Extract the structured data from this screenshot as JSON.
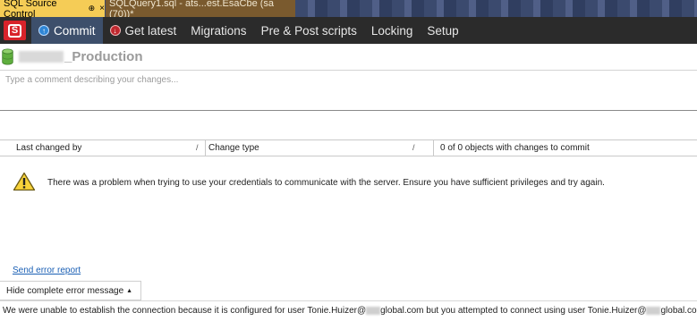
{
  "tabs": {
    "active_label": "SQL Source Control",
    "active_pin": "⊕",
    "active_close": "×",
    "query_label": "SQLQuery1.sql - ats...est.EsaCbe (sa (70))*"
  },
  "toolbar": {
    "logo_text": "S",
    "items": [
      {
        "label": "Commit",
        "icon": "commit-icon",
        "active": true
      },
      {
        "label": "Get latest",
        "icon": "get-latest-icon",
        "active": false
      },
      {
        "label": "Migrations",
        "active": false
      },
      {
        "label": "Pre & Post scripts",
        "active": false
      },
      {
        "label": "Locking",
        "active": false
      },
      {
        "label": "Setup",
        "active": false
      }
    ]
  },
  "database": {
    "name_suffix": "_Production",
    "icon": "database-icon"
  },
  "comment": {
    "placeholder": "Type a comment describing your changes..."
  },
  "grid": {
    "col_last_changed": "Last changed by",
    "col_change_type": "Change type",
    "sort_glyph": "/",
    "objects_count": "0 of 0 objects with changes to commit"
  },
  "error": {
    "message": "There was a problem when trying to use your credentials to communicate with the server. Ensure you have sufficient privileges and try again.",
    "send_report": "Send error report",
    "hide_button": "Hide complete error message",
    "hide_caret": "▲",
    "detail_part1": "We were unable to establish the connection because it is configured for user Tonie.Huizer@",
    "detail_part2": "global.com but you attempted to connect using user Tonie.Huizer@",
    "detail_part3": "global.com. To co"
  },
  "colors": {
    "active_tab": "#f5cc56",
    "toolbar_bg": "#2b2b2b",
    "active_nav": "#3d4f6b",
    "logo_red": "#d8232a",
    "link": "#1a5fb4"
  }
}
